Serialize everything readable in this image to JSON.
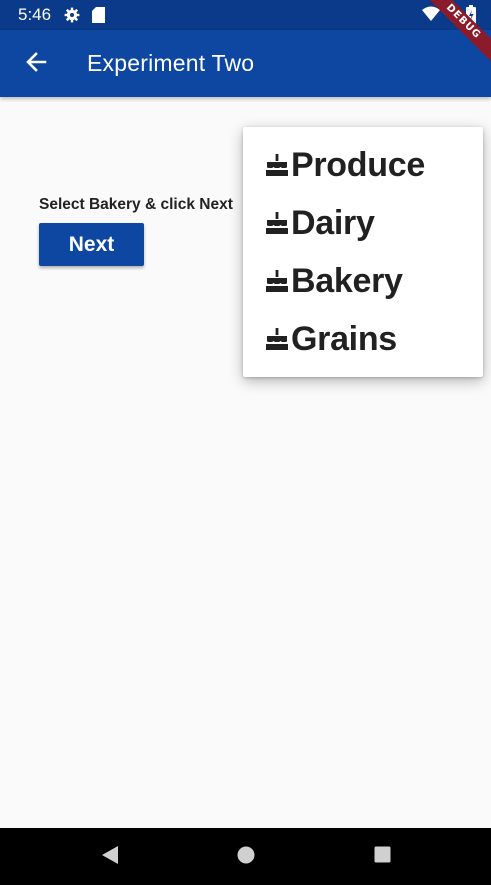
{
  "status_bar": {
    "time": "5:46",
    "icons": [
      "gear-icon",
      "sd-card-icon",
      "wifi-icon",
      "battery-icon"
    ]
  },
  "app_bar": {
    "title": "Experiment Two",
    "back_icon": "arrow-left-icon"
  },
  "debug_banner": "DEBUG",
  "main": {
    "instruction": "Select Bakery & click Next",
    "next_label": "Next"
  },
  "menu": {
    "items": [
      {
        "label": "Produce",
        "icon": "cake-icon"
      },
      {
        "label": "Dairy",
        "icon": "cake-icon"
      },
      {
        "label": "Bakery",
        "icon": "cake-icon"
      },
      {
        "label": "Grains",
        "icon": "cake-icon"
      }
    ]
  },
  "nav_bar": {
    "icons": [
      "back-triangle-icon",
      "home-circle-icon",
      "recents-square-icon"
    ]
  },
  "colors": {
    "primary": "#0d47a1",
    "status_bar": "#0b3a8a",
    "background": "#fafafa",
    "debug": "#8b1a2a"
  }
}
